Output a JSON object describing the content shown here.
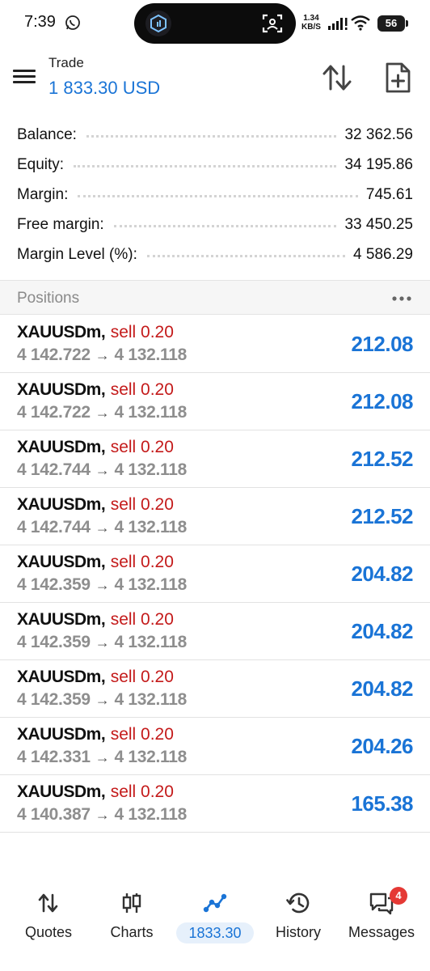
{
  "status_bar": {
    "time": "7:39",
    "net_speed_value": "1.34",
    "net_speed_unit": "KB/S",
    "battery": "56"
  },
  "header": {
    "title": "Trade",
    "subtitle": "1 833.30 USD"
  },
  "summary": [
    {
      "label": "Balance:",
      "value": "32 362.56"
    },
    {
      "label": "Equity:",
      "value": "34 195.86"
    },
    {
      "label": "Margin:",
      "value": "745.61"
    },
    {
      "label": "Free margin:",
      "value": "33 450.25"
    },
    {
      "label": "Margin Level (%):",
      "value": "4 586.29"
    }
  ],
  "positions_header": {
    "title": "Positions"
  },
  "positions": [
    {
      "symbol": "XAUUSDm",
      "side": "sell 0.20",
      "open": "4 142.722",
      "current": "4 132.118",
      "profit": "212.08"
    },
    {
      "symbol": "XAUUSDm",
      "side": "sell 0.20",
      "open": "4 142.722",
      "current": "4 132.118",
      "profit": "212.08"
    },
    {
      "symbol": "XAUUSDm",
      "side": "sell 0.20",
      "open": "4 142.744",
      "current": "4 132.118",
      "profit": "212.52"
    },
    {
      "symbol": "XAUUSDm",
      "side": "sell 0.20",
      "open": "4 142.744",
      "current": "4 132.118",
      "profit": "212.52"
    },
    {
      "symbol": "XAUUSDm",
      "side": "sell 0.20",
      "open": "4 142.359",
      "current": "4 132.118",
      "profit": "204.82"
    },
    {
      "symbol": "XAUUSDm",
      "side": "sell 0.20",
      "open": "4 142.359",
      "current": "4 132.118",
      "profit": "204.82"
    },
    {
      "symbol": "XAUUSDm",
      "side": "sell 0.20",
      "open": "4 142.359",
      "current": "4 132.118",
      "profit": "204.82"
    },
    {
      "symbol": "XAUUSDm",
      "side": "sell 0.20",
      "open": "4 142.331",
      "current": "4 132.118",
      "profit": "204.26"
    },
    {
      "symbol": "XAUUSDm",
      "side": "sell 0.20",
      "open": "4 140.387",
      "current": "4 132.118",
      "profit": "165.38"
    }
  ],
  "nav": {
    "quotes": "Quotes",
    "charts": "Charts",
    "trade": "1833.30",
    "history": "History",
    "messages": "Messages",
    "messages_badge": "4"
  },
  "colors": {
    "accent": "#1a74d6",
    "sell": "#c41a1a",
    "muted": "#8e8e8e",
    "badge": "#e53935"
  },
  "icons": {
    "status": [
      "whatsapp-icon",
      "signal-icon",
      "wifi-icon",
      "battery-icon"
    ],
    "header": [
      "menu-icon",
      "sort-icon",
      "new-document-icon"
    ],
    "nav": [
      "quotes-icon",
      "charts-icon",
      "trade-icon",
      "history-icon",
      "messages-icon"
    ]
  }
}
